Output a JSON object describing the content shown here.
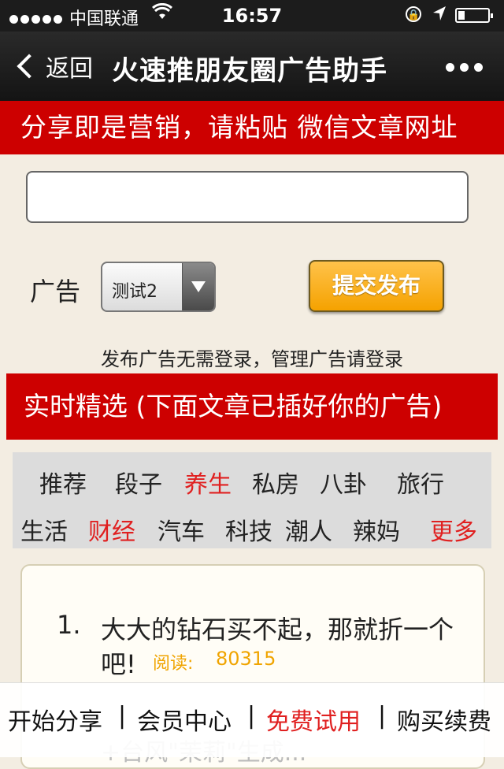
{
  "status_bar": {
    "carrier": "中国联通",
    "time": "16:57",
    "icons": [
      "signal-dots-icon",
      "wifi-icon",
      "rotation-lock-icon",
      "location-arrow-icon",
      "battery-icon"
    ]
  },
  "nav": {
    "back_label": "返回",
    "title": "火速推朋友圈广告助手",
    "more_icon": "more-dots-icon"
  },
  "banner_top": "分享即是营销，请粘贴 微信文章网址",
  "url_input": {
    "value": "",
    "placeholder": ""
  },
  "ad_form": {
    "label": "广告",
    "select_value": "测试2",
    "submit_label": "提交发布",
    "hint": "发布广告无需登录，管理广告请登录"
  },
  "banner_section": "实时精选 (下面文章已插好你的广告)",
  "categories": {
    "row1": [
      "推荐",
      "段子",
      "养生",
      "私房",
      "八卦",
      "旅行"
    ],
    "row2": [
      "生活",
      "财经",
      "汽车",
      "科技",
      "潮人",
      "辣妈",
      "更多"
    ],
    "highlight_color": "#e02020"
  },
  "articles": [
    {
      "number": "1.",
      "title_line1": "大大的钻石买不起，那就折一个",
      "title_line2": "吧!",
      "read_label": "阅读:",
      "read_count": "80315"
    },
    {
      "partial_text": "+台风\"茉莉\"生成..."
    }
  ],
  "bottom_bar": {
    "items": [
      "开始分享",
      "会员中心",
      "免费试用",
      "购买续费"
    ],
    "separator": "|"
  },
  "colors": {
    "banner_red": "#cd0000",
    "submit_orange": "#f5a200",
    "read_orange": "#f0a400"
  }
}
